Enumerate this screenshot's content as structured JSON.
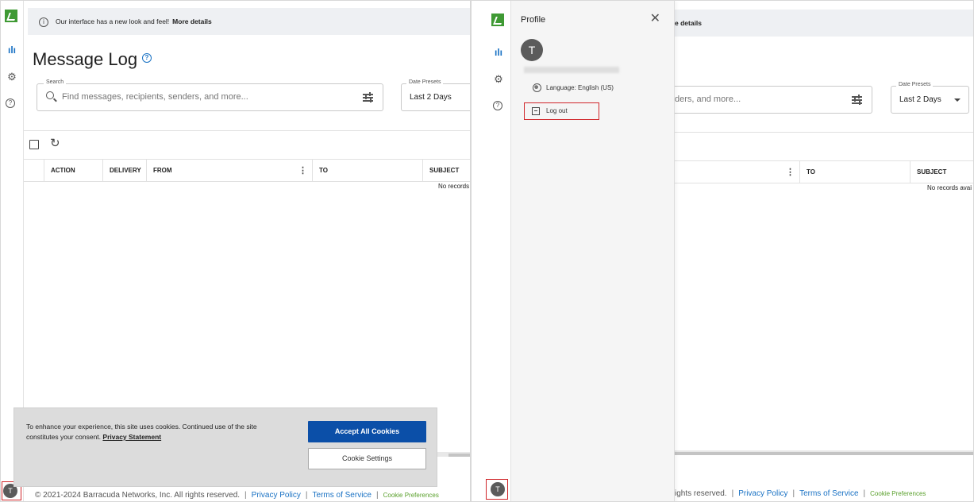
{
  "banner": {
    "text": "Our interface has a new look and feel!",
    "link": "More details",
    "link_partial": "e details"
  },
  "page": {
    "title": "Message Log",
    "help_glyph": "?"
  },
  "search": {
    "label": "Search",
    "placeholder": "Find messages, recipients, senders, and more...",
    "placeholder_partial": "ders, and more..."
  },
  "date_presets": {
    "label": "Date Presets",
    "value": "Last 2 Days"
  },
  "table": {
    "columns": [
      "ACTION",
      "DELIVERY",
      "FROM",
      "TO",
      "SUBJECT"
    ],
    "empty_left": "No records",
    "empty_right": "No records avai"
  },
  "cookie": {
    "text": "To enhance your experience, this site uses cookies. Continued use of the site constitutes your consent.",
    "privacy_link": "Privacy Statement",
    "accept_label": "Accept All Cookies",
    "settings_label": "Cookie Settings"
  },
  "footer": {
    "copyright": "© 2021-2024 Barracuda Networks, Inc. All rights reserved.",
    "copyright_partial": "ights reserved.",
    "privacy": "Privacy Policy",
    "terms": "Terms of Service",
    "cookie_prefs": "Cookie Preferences",
    "sep": "|"
  },
  "avatar": {
    "initial": "T"
  },
  "profile": {
    "title": "Profile",
    "close_glyph": "✕",
    "initial": "T",
    "language": "Language: English (US)",
    "logout": "Log out"
  },
  "icons": {
    "bars": "ılı",
    "gear": "⚙",
    "help": "?",
    "info": "i",
    "refresh": "↻",
    "kebab": "⋮"
  },
  "colors": {
    "brand_green": "#3f9a34",
    "link_blue": "#1a72c4",
    "accept_button": "#0b4fa8",
    "highlight_red": "#d0262a",
    "cookie_pref_green": "#5aa02c"
  }
}
